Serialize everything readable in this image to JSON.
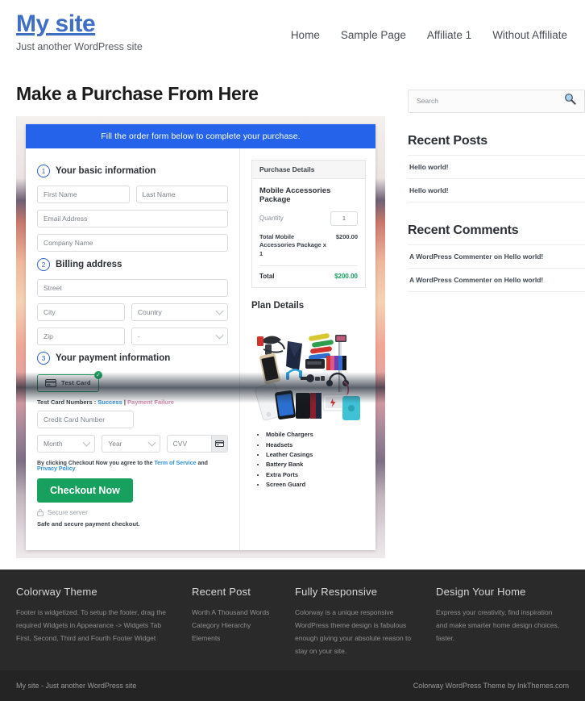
{
  "header": {
    "site_title": "My site",
    "site_description": "Just another WordPress site",
    "nav": [
      {
        "label": "Home"
      },
      {
        "label": "Sample Page"
      },
      {
        "label": "Affiliate 1"
      },
      {
        "label": "Without Affiliate"
      }
    ]
  },
  "main": {
    "page_title": "Make a Purchase From Here",
    "form": {
      "banner": "Fill the order form below to complete your purchase.",
      "steps": {
        "one_num": "1",
        "one_label": "Your basic information",
        "two_num": "2",
        "two_label": "Billing address",
        "three_num": "3",
        "three_label": "Your payment information"
      },
      "fields": {
        "first_name": "First Name",
        "last_name": "Last Name",
        "email": "Email Address",
        "company": "Company Name",
        "street": "Street",
        "city": "City",
        "country": "Country",
        "zip": "Zip",
        "state": "-",
        "credit_card": "Credit Card Number",
        "month": "Month",
        "year": "Year",
        "cvv": "CVV"
      },
      "payment": {
        "card_tab_label": "Test Card",
        "card_tab_checked": "✓",
        "test_cards_prefix": "Test Card Numbers : ",
        "test_card_success": "Success",
        "test_card_divider": " | ",
        "test_card_failure": "Payment Failure"
      },
      "terms": {
        "prefix": "By clicking Checkout Now you agree to the ",
        "tos": "Term of Service",
        "and": " and ",
        "privacy": "Privacy Policy"
      },
      "checkout_button": "Checkout Now",
      "secure_server": "Secure server",
      "safe_note": "Safe and secure payment checkout."
    },
    "purchase_details": {
      "heading": "Purchase Details",
      "package_title": "Mobile Accessories Package",
      "quantity_label": "Quantity",
      "quantity_value": "1",
      "line_label": "Total Mobile Accessories Package x 1",
      "line_amount": "$200.00",
      "total_label": "Total",
      "total_amount": "$200.00"
    },
    "plan": {
      "title": "Plan Details",
      "features": [
        "Mobile Chargers",
        "Headsets",
        "Leather Casings",
        "Battery Bank",
        "Extra Ports",
        "Screen Guard"
      ]
    }
  },
  "sidebar": {
    "search_placeholder": "Search",
    "recent_posts_heading": "Recent Posts",
    "recent_posts": [
      "Hello world!",
      "Hello world!"
    ],
    "recent_comments_heading": "Recent Comments",
    "recent_comments": [
      "A WordPress Commenter on Hello world!",
      "A WordPress Commenter on Hello world!"
    ]
  },
  "footer": {
    "columns": [
      {
        "heading": "Colorway Theme",
        "text": "Footer is widgetized. To setup the footer, drag the required Widgets in Appearance -> Widgets Tab First, Second, Third and Fourth Footer Widget"
      },
      {
        "heading": "Recent Post",
        "items": [
          "Worth A Thousand Words",
          "Category Hierarchy",
          "Elements"
        ]
      },
      {
        "heading": "Fully Responsive",
        "text": "Colorway is a unique responsive WordPress theme design is fabulous enough giving your absolute reason to stay on your site."
      },
      {
        "heading": "Design Your Home",
        "text": "Express your creativity, find inspiration and make smarter home design choices, faster."
      }
    ],
    "copyright_left": "My site - Just another WordPress site",
    "copyright_right": "Colorway WordPress Theme by InkThemes.com"
  },
  "colors": {
    "brand_blue": "#3f6fc4",
    "banner_blue": "#2563eb",
    "success_green": "#17a05e",
    "footer_bg": "#2a2a2a"
  }
}
